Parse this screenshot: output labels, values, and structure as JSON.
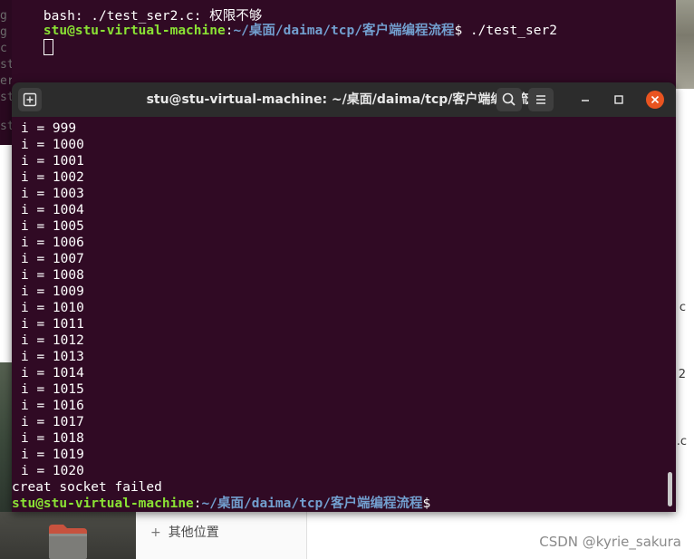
{
  "background_terminal": {
    "line1_text": "bash: ./test_ser2.c: 权限不够",
    "prompt_user": "stu@stu-virtual-machine",
    "prompt_sep": ":",
    "prompt_path": "~/桌面/daima/tcp/客户端编程流程",
    "prompt_suffix": "$ ./test_ser2"
  },
  "terminal": {
    "title": "stu@stu-virtual-machine: ~/桌面/daima/tcp/客户端编程流程",
    "output_lines": [
      "i = 999",
      "i = 1000",
      "i = 1001",
      "i = 1002",
      "i = 1003",
      "i = 1004",
      "i = 1005",
      "i = 1006",
      "i = 1007",
      "i = 1008",
      "i = 1009",
      "i = 1010",
      "i = 1011",
      "i = 1012",
      "i = 1013",
      "i = 1014",
      "i = 1015",
      "i = 1016",
      "i = 1017",
      "i = 1018",
      "i = 1019",
      "i = 1020"
    ],
    "error_line": "creat socket failed",
    "final_prompt_user": "stu@stu-virtual-machine",
    "final_prompt_sep": ":",
    "final_prompt_path": "~/桌面/daima/tcp/客户端编程流程",
    "final_prompt_suffix": "$"
  },
  "file_manager": {
    "other_locations_label": "其他位置",
    "plus_glyph": "+"
  },
  "watermark": "CSDN @kyrie_sakura",
  "background_fragments": {
    "left": [
      "g",
      "g",
      "c",
      "st",
      "er",
      "st",
      "st"
    ],
    "right": [
      "c",
      "2",
      ".c"
    ]
  },
  "colors": {
    "terminal_bg": "#300a24",
    "prompt_user": "#8ae234",
    "prompt_path": "#729fcf",
    "close_button": "#e95420",
    "titlebar": "#2c2c2c"
  },
  "icons": {
    "new_tab": "new-tab-icon",
    "search": "search-icon",
    "menu": "hamburger-menu-icon",
    "minimize": "minimize-icon",
    "maximize": "maximize-icon",
    "close": "close-icon",
    "folder": "folder-icon"
  }
}
